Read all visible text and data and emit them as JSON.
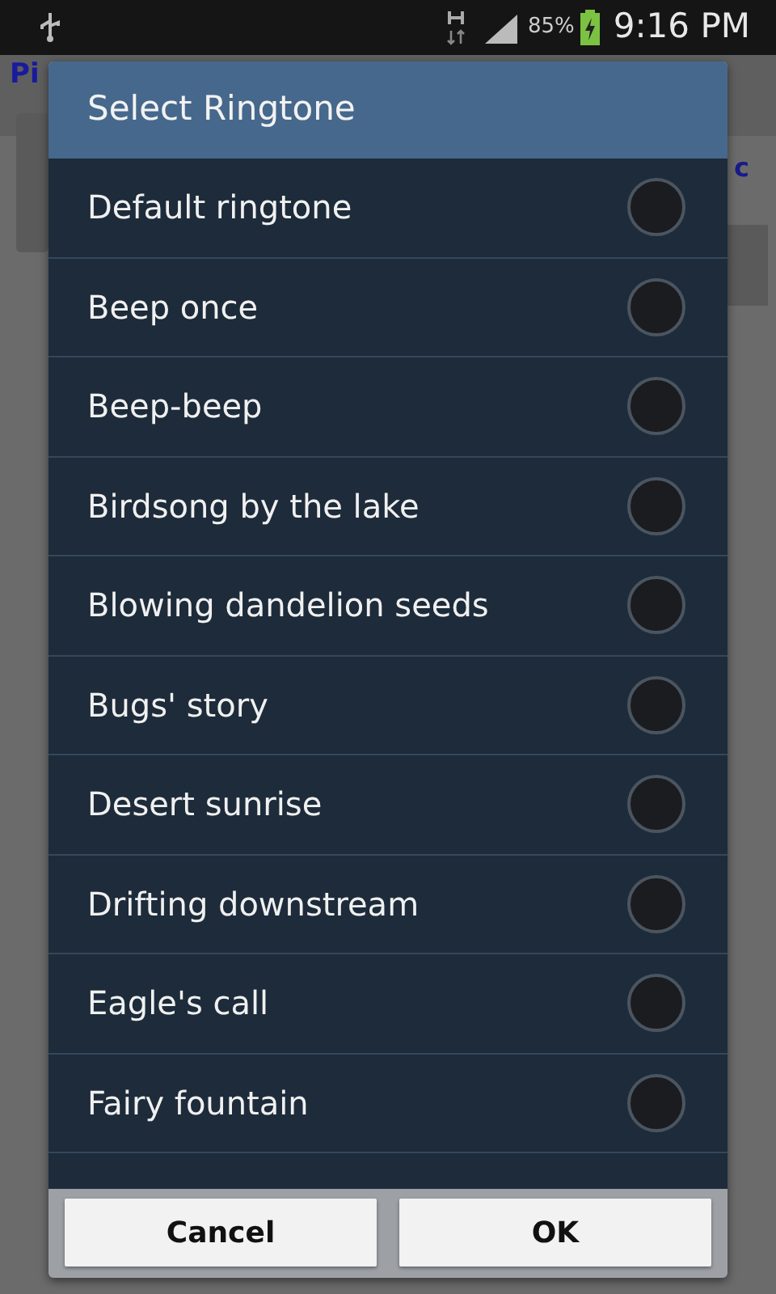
{
  "status_bar": {
    "battery": "85%",
    "time": "9:16 PM"
  },
  "background": {
    "title": "Pi",
    "text": "c"
  },
  "dialog": {
    "title": "Select Ringtone",
    "items": [
      {
        "label": "Default ringtone",
        "selected": false
      },
      {
        "label": "Beep once",
        "selected": false
      },
      {
        "label": "Beep-beep",
        "selected": false
      },
      {
        "label": "Birdsong by the lake",
        "selected": false
      },
      {
        "label": "Blowing dandelion seeds",
        "selected": false
      },
      {
        "label": "Bugs' story",
        "selected": false
      },
      {
        "label": "Desert sunrise",
        "selected": false
      },
      {
        "label": "Drifting downstream",
        "selected": false
      },
      {
        "label": "Eagle's call",
        "selected": false
      },
      {
        "label": "Fairy fountain",
        "selected": false
      }
    ],
    "buttons": [
      "Cancel",
      "OK"
    ]
  }
}
